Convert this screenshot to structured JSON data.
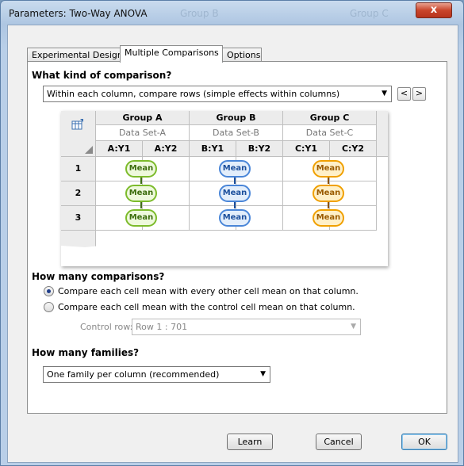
{
  "window": {
    "title": "Parameters: Two-Way ANOVA",
    "ghost_text_left": "Group B",
    "ghost_text_right": "Group C",
    "close_glyph": "x"
  },
  "tabs": [
    {
      "label": "Experimental Design",
      "active": false
    },
    {
      "label": "Multiple Comparisons",
      "active": true
    },
    {
      "label": "Options",
      "active": false
    }
  ],
  "comparison": {
    "heading": "What kind of comparison?",
    "selected": "Within each column, compare rows (simple effects within columns)",
    "prev_glyph": "<",
    "next_glyph": ">"
  },
  "grid": {
    "corner_icon": "table-settings-icon",
    "groups": [
      {
        "name": "Group A",
        "dataset": "Data Set-A",
        "columns": [
          "A:Y1",
          "A:Y2"
        ],
        "color": "#7cbb2b"
      },
      {
        "name": "Group B",
        "dataset": "Data Set-B",
        "columns": [
          "B:Y1",
          "B:Y2"
        ],
        "color": "#4a86d8"
      },
      {
        "name": "Group C",
        "dataset": "Data Set-C",
        "columns": [
          "C:Y1",
          "C:Y2"
        ],
        "color": "#f0a000"
      }
    ],
    "rows": [
      "1",
      "2",
      "3"
    ],
    "cell_label": "Mean"
  },
  "how_many": {
    "heading": "How many comparisons?",
    "option_every": "Compare each cell mean with every other cell mean on that column.",
    "option_control": "Compare each cell mean with the control cell mean on that column.",
    "selected": "every",
    "control_row_label": "Control row:",
    "control_row_value": "Row 1 : 701"
  },
  "families": {
    "heading": "How many families?",
    "selected": "One family per column (recommended)"
  },
  "buttons": {
    "learn": "Learn",
    "cancel": "Cancel",
    "ok": "OK"
  }
}
